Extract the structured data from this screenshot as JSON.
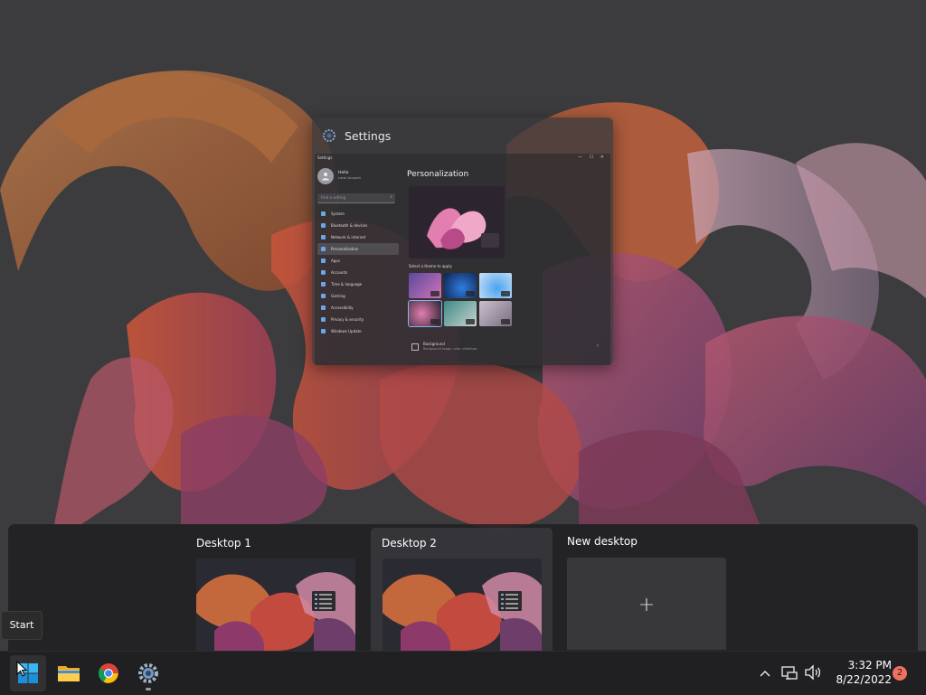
{
  "settings_window": {
    "title": "Settings",
    "mini": {
      "app_title": "Settings",
      "user_name": "Hello",
      "user_sub": "Local Account",
      "search_placeholder": "Find a setting",
      "nav": [
        {
          "label": "System",
          "selected": false
        },
        {
          "label": "Bluetooth & devices",
          "selected": false
        },
        {
          "label": "Network & internet",
          "selected": false
        },
        {
          "label": "Personalization",
          "selected": true
        },
        {
          "label": "Apps",
          "selected": false
        },
        {
          "label": "Accounts",
          "selected": false
        },
        {
          "label": "Time & language",
          "selected": false
        },
        {
          "label": "Gaming",
          "selected": false
        },
        {
          "label": "Accessibility",
          "selected": false
        },
        {
          "label": "Privacy & security",
          "selected": false
        },
        {
          "label": "Windows Update",
          "selected": false
        }
      ],
      "page_title": "Personalization",
      "themes_label": "Select a theme to apply",
      "background_title": "Background",
      "background_sub": "Background image, color, slideshow"
    }
  },
  "virtual_desktops": {
    "desktop_1_label": "Desktop 1",
    "desktop_2_label": "Desktop 2",
    "new_desktop_label": "New desktop",
    "new_desktop_plus": "+"
  },
  "tooltip": {
    "text": "Start"
  },
  "taskbar": {
    "apps": [
      "start-icon",
      "file-explorer-icon",
      "chrome-icon",
      "settings-icon"
    ],
    "time": "3:32 PM",
    "date": "8/22/2022",
    "notification_count": "2"
  },
  "colors": {
    "accent": "#4cc2ff",
    "taskbar_bg": "#202022",
    "badge": "#f07060"
  }
}
